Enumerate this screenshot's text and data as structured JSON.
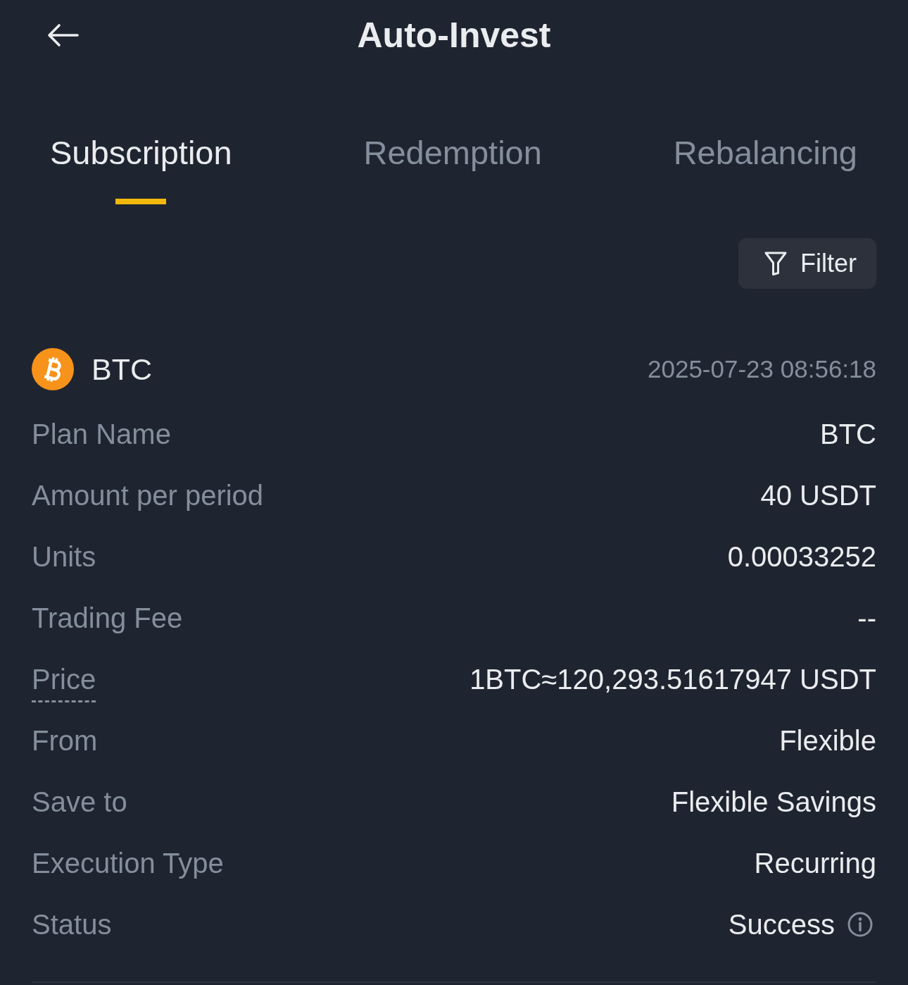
{
  "header": {
    "title": "Auto-Invest"
  },
  "tabs": [
    {
      "label": "Subscription",
      "selected": true
    },
    {
      "label": "Redemption",
      "selected": false
    },
    {
      "label": "Rebalancing",
      "selected": false
    }
  ],
  "filter_button": {
    "label": "Filter"
  },
  "record": {
    "asset": "BTC",
    "time": "2025-07-23 08:56:18",
    "fields": [
      {
        "kind": "plain",
        "label": "Plan Name",
        "value": "BTC"
      },
      {
        "kind": "plain",
        "label": "Amount per period",
        "value": "40 USDT"
      },
      {
        "kind": "plain",
        "label": "Units",
        "value": "0.00033252"
      },
      {
        "kind": "plain",
        "label": "Trading Fee",
        "value": "--"
      },
      {
        "kind": "hint",
        "label": "Price",
        "value": "1BTC≈120,293.51617947 USDT"
      },
      {
        "kind": "plain",
        "label": "From",
        "value": "Flexible"
      },
      {
        "kind": "plain",
        "label": "Save to",
        "value": "Flexible Savings"
      },
      {
        "kind": "plain",
        "label": "Execution Type",
        "value": "Recurring"
      },
      {
        "kind": "status",
        "label": "Status",
        "value": "Success"
      }
    ]
  }
}
